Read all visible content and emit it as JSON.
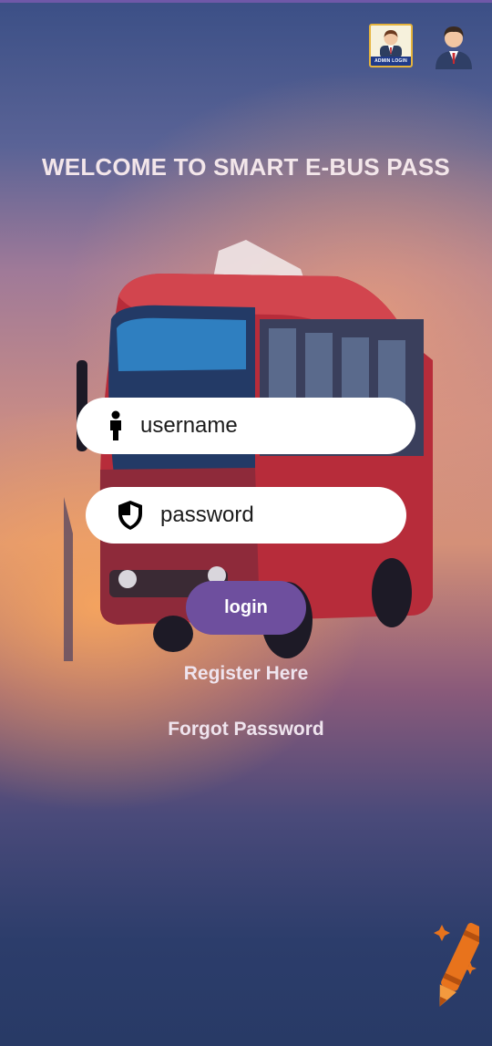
{
  "header": {
    "admin_badge_caption": "ADMIN LOGIN",
    "title": "WELCOME TO SMART E-BUS PASS"
  },
  "form": {
    "username_placeholder": "username",
    "password_placeholder": "password",
    "login_label": "login"
  },
  "links": {
    "register": "Register Here",
    "forgot": "Forgot Password"
  },
  "icons": {
    "username": "person-icon",
    "password": "shield-icon",
    "fab": "crayon-sparkle-icon"
  },
  "colors": {
    "accent": "#6e4f9e",
    "badge_border": "#e6b43c",
    "fab": "#e8731c"
  }
}
